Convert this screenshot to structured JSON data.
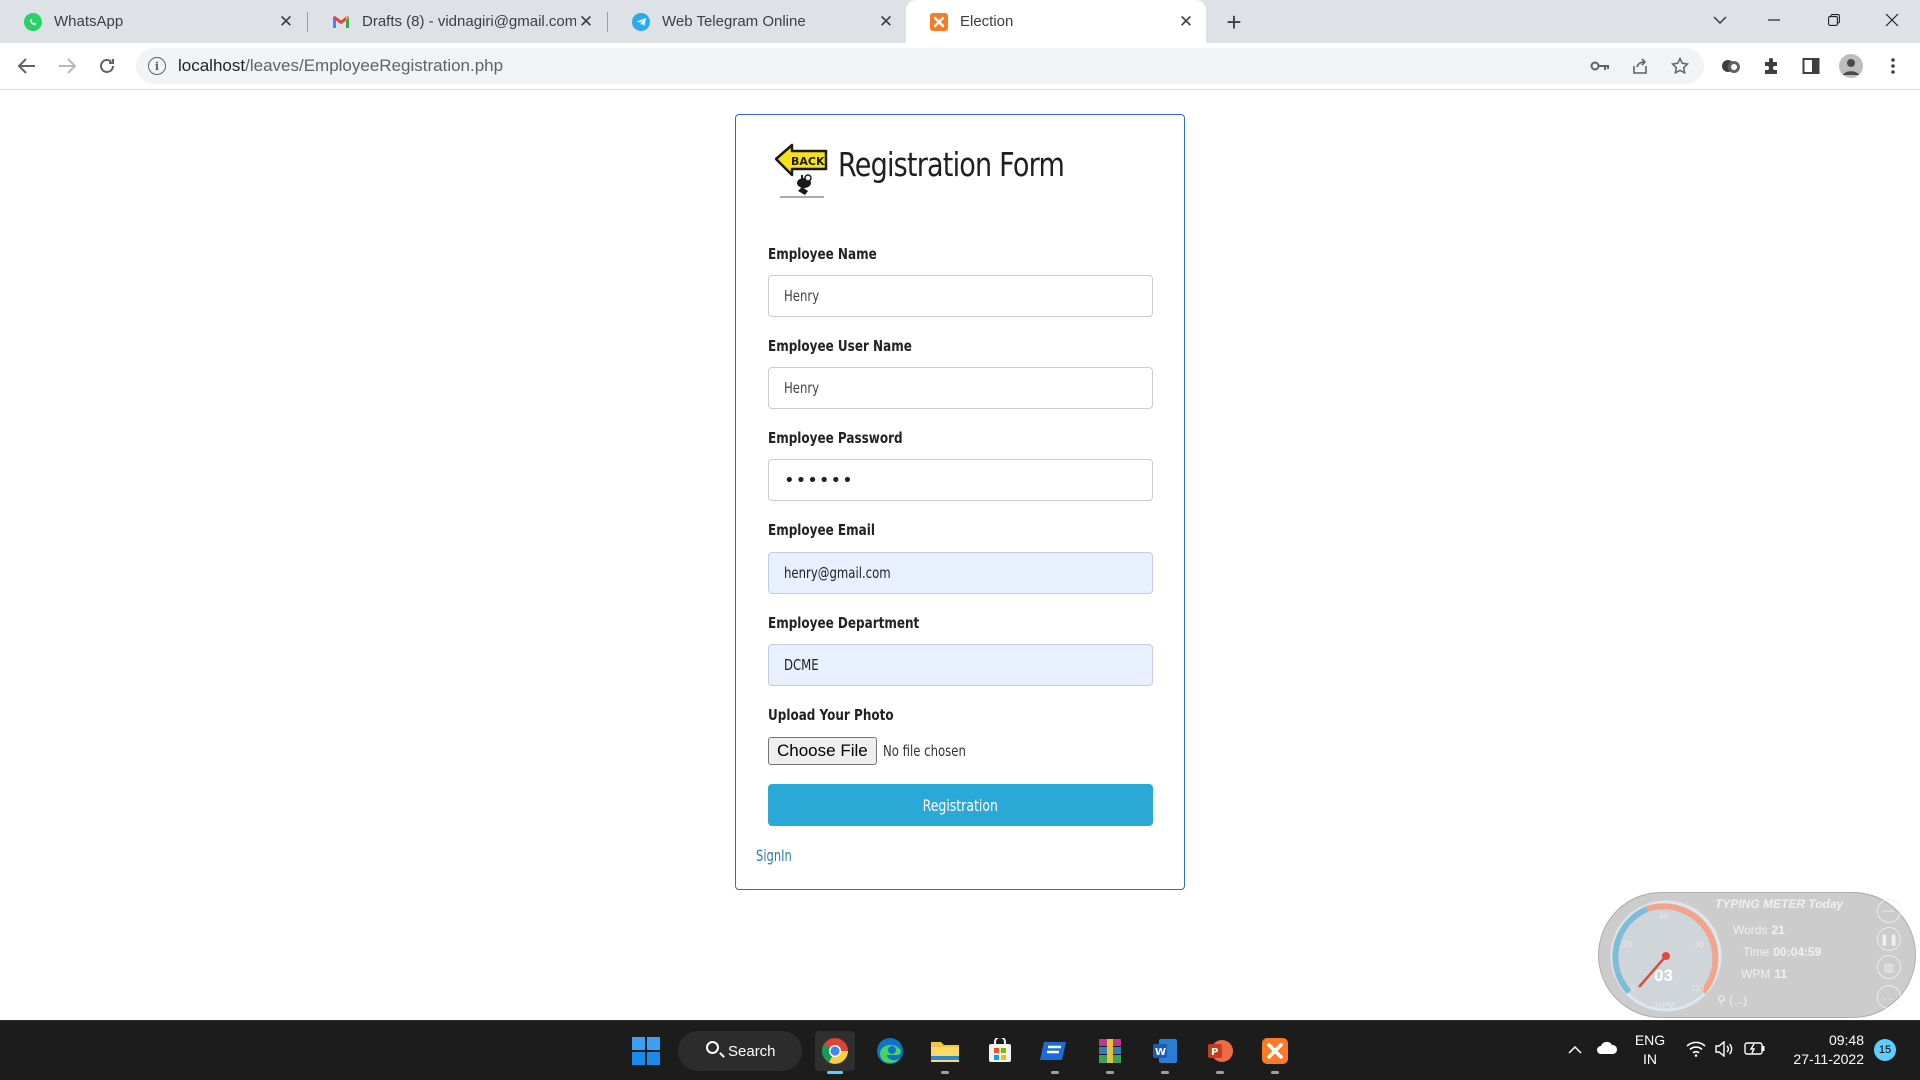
{
  "browser": {
    "tabs": [
      {
        "title": "WhatsApp",
        "icon": "whatsapp-icon",
        "active": false
      },
      {
        "title": "Drafts (8) - vidnagiri@gmail.com",
        "icon": "gmail-icon",
        "active": false
      },
      {
        "title": "Web Telegram Online",
        "icon": "telegram-icon",
        "active": false
      },
      {
        "title": "Election",
        "icon": "xampp-icon",
        "active": true
      }
    ],
    "close_glyph": "✕",
    "new_tab_glyph": "+",
    "url_host": "localhost",
    "url_path": "/leaves/EmployeeRegistration.php"
  },
  "form": {
    "title": "Registration Form",
    "back_logo_text": "BACK",
    "fields": [
      {
        "label": "Employee Name",
        "value": "Henry",
        "type": "text"
      },
      {
        "label": "Employee User Name",
        "value": "Henry",
        "type": "text"
      },
      {
        "label": "Employee Password",
        "value": "••••••",
        "type": "password"
      },
      {
        "label": "Employee Email",
        "value": "henry@gmail.com",
        "type": "email",
        "autofilled": true
      },
      {
        "label": "Employee Department",
        "value": "DCME",
        "type": "text",
        "autofilled": true
      }
    ],
    "photo_label": "Upload Your Photo",
    "choose_file_label": "Choose File",
    "no_file_text": "No file chosen",
    "submit_label": "Registration",
    "signin_link": "SignIn"
  },
  "typing_meter": {
    "title": "TYPING METER Today",
    "words_label": "Words",
    "words_value": "21",
    "time_label": "Time",
    "time_value": "00:04:59",
    "wpm_label": "WPM",
    "wpm_value": "11",
    "gauge_value": "03",
    "gauge_unit": "WPM",
    "gauge_ticks": [
      "0",
      "20",
      "40",
      "80",
      "120"
    ],
    "search_text": "(...)"
  },
  "taskbar": {
    "search_label": "Search",
    "language_top": "ENG",
    "language_bottom": "IN",
    "time": "09:48",
    "date": "27-11-2022",
    "notification_count": "15"
  },
  "colors": {
    "accent_button": "#2aa9d6",
    "card_border": "#2d6fb8",
    "link": "#337ab7",
    "autofill_bg": "#e8f0fe",
    "tab_strip": "#dee1e6",
    "taskbar": "#1c1c1c"
  }
}
